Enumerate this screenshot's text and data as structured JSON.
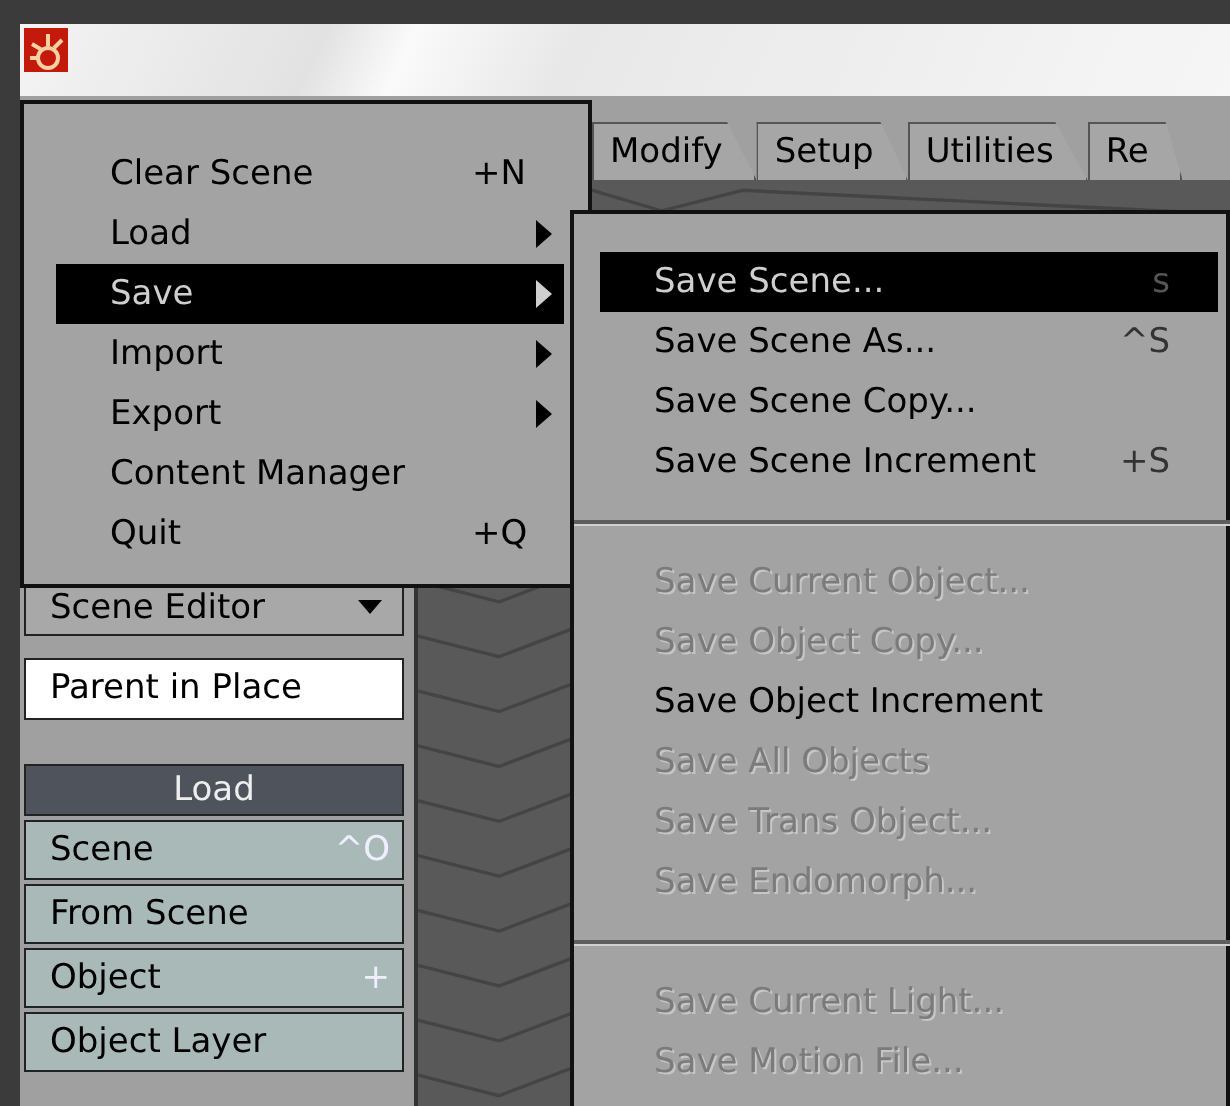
{
  "tabs": [
    {
      "label": "Modify",
      "selected": false
    },
    {
      "label": "Setup",
      "selected": false
    },
    {
      "label": "Utilities",
      "selected": false
    },
    {
      "label": "Re",
      "selected": false
    }
  ],
  "left_panel": {
    "dropdown": "Scene Editor",
    "field_value": "Parent in Place",
    "section_title": "Load",
    "buttons": [
      {
        "label": "Scene",
        "shortcut": "^O"
      },
      {
        "label": "From Scene"
      },
      {
        "label": "Object",
        "shortcut": "+"
      },
      {
        "label": "Object Layer"
      }
    ]
  },
  "file_menu": [
    {
      "label": "Clear Scene",
      "shortcut": "+N",
      "submenu": false,
      "selected": false
    },
    {
      "label": "Load",
      "submenu": true,
      "selected": false
    },
    {
      "label": "Save",
      "submenu": true,
      "selected": true
    },
    {
      "label": "Import",
      "submenu": true,
      "selected": false
    },
    {
      "label": "Export",
      "submenu": true,
      "selected": false
    },
    {
      "label": "Content Manager",
      "submenu": false,
      "selected": false
    },
    {
      "label": "Quit",
      "shortcut": "+Q",
      "submenu": false,
      "selected": false
    }
  ],
  "save_submenu": [
    [
      {
        "label": "Save Scene...",
        "shortcut": "s",
        "selected": true,
        "disabled": false
      },
      {
        "label": "Save Scene As...",
        "shortcut": "^S",
        "selected": false,
        "disabled": false
      },
      {
        "label": "Save Scene Copy...",
        "selected": false,
        "disabled": false
      },
      {
        "label": "Save Scene Increment",
        "shortcut": "+S",
        "selected": false,
        "disabled": false
      }
    ],
    [
      {
        "label": "Save Current Object...",
        "selected": false,
        "disabled": true
      },
      {
        "label": "Save Object Copy...",
        "selected": false,
        "disabled": true
      },
      {
        "label": "Save Object Increment",
        "selected": false,
        "disabled": false
      },
      {
        "label": "Save All Objects",
        "selected": false,
        "disabled": true
      },
      {
        "label": "Save Trans Object...",
        "selected": false,
        "disabled": true
      },
      {
        "label": "Save Endomorph...",
        "selected": false,
        "disabled": true
      }
    ],
    [
      {
        "label": "Save Current Light...",
        "selected": false,
        "disabled": true
      },
      {
        "label": "Save Motion File...",
        "selected": false,
        "disabled": true
      }
    ]
  ]
}
